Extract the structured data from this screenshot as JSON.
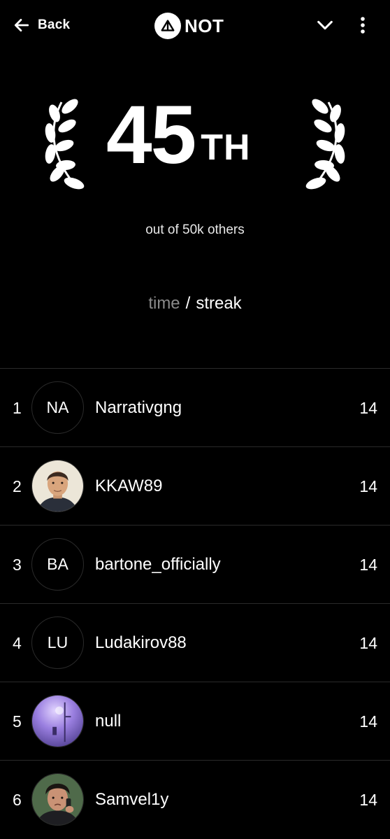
{
  "header": {
    "back_label": "Back",
    "brand_name": "NOT"
  },
  "rank": {
    "number": "45",
    "suffix": "TH",
    "subtitle": "out of 50k others"
  },
  "toggle": {
    "option_time": "time",
    "separator": "/",
    "option_streak": "streak",
    "active": "streak"
  },
  "leaderboard": [
    {
      "rank": "1",
      "initials": "NA",
      "name": "Narrativgng",
      "score": "14",
      "avatar": "initials"
    },
    {
      "rank": "2",
      "initials": "",
      "name": "KKAW89",
      "score": "14",
      "avatar": "portrait-man-icon"
    },
    {
      "rank": "3",
      "initials": "BA",
      "name": "bartone_officially",
      "score": "14",
      "avatar": "initials"
    },
    {
      "rank": "4",
      "initials": "LU",
      "name": "Ludakirov88",
      "score": "14",
      "avatar": "initials"
    },
    {
      "rank": "5",
      "initials": "",
      "name": "null",
      "score": "14",
      "avatar": "purple-street-photo-icon"
    },
    {
      "rank": "6",
      "initials": "",
      "name": "Samvel1y",
      "score": "14",
      "avatar": "portrait-man-phone-icon"
    }
  ],
  "colors": {
    "background": "#000000",
    "text": "#ffffff",
    "muted_text": "#8a8a8a",
    "divider": "#2a2a2a"
  }
}
